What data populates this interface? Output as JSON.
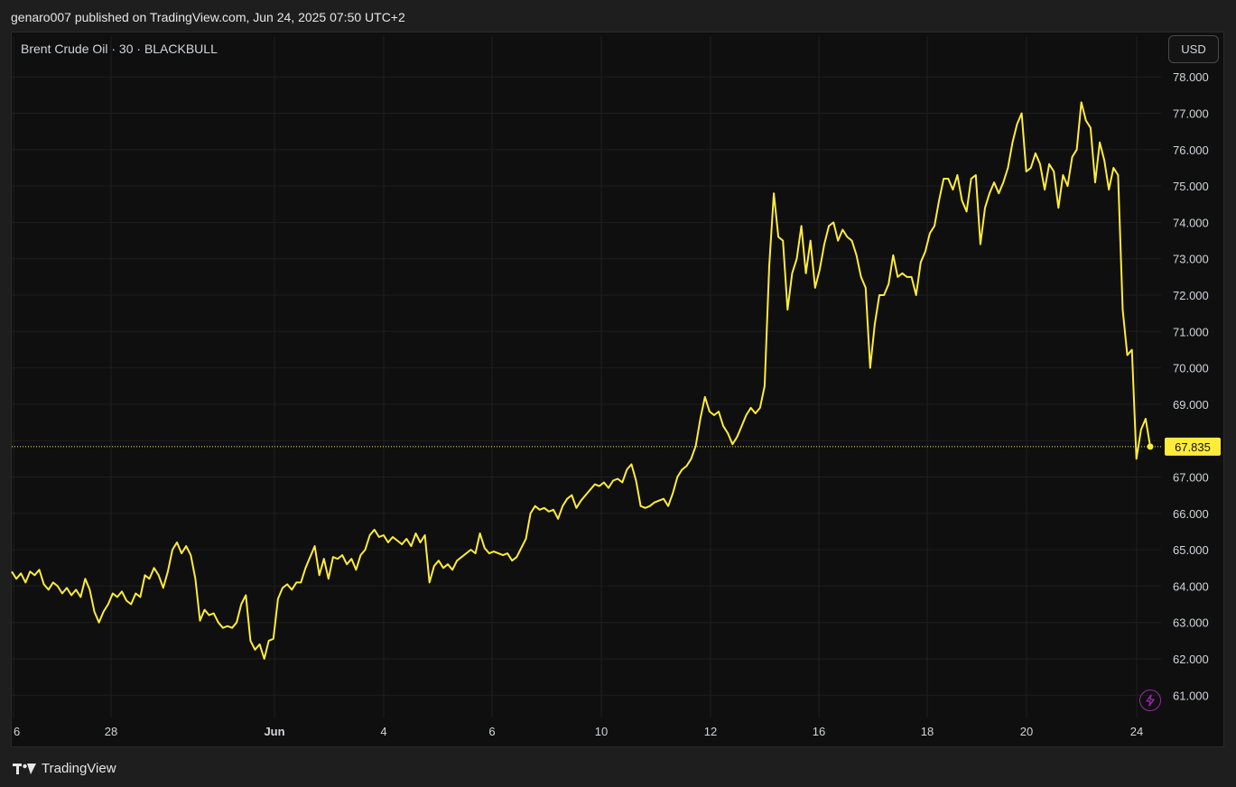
{
  "header": {
    "publish_text": "genaro007 published on TradingView.com, Jun 24, 2025 07:50 UTC+2"
  },
  "symbol": {
    "label": "Brent Crude Oil · 30 · BLACKBULL"
  },
  "currency": "USD",
  "brand": "TradingView",
  "icons": {
    "brand": "tradingview-logo-icon",
    "lightning": "lightning-icon"
  },
  "colors": {
    "line": "#ffeb3b",
    "background": "#0f0f0f",
    "grid": "#1f1f1f",
    "accent_purple": "#9c27b0"
  },
  "chart_data": {
    "type": "line",
    "ylim": [
      60.65,
      79.2
    ],
    "y_ticks": [
      "78.000",
      "77.000",
      "76.000",
      "75.000",
      "74.000",
      "73.000",
      "72.000",
      "71.000",
      "70.000",
      "69.000",
      "67.000",
      "66.000",
      "65.000",
      "64.000",
      "63.000",
      "62.000",
      "61.000"
    ],
    "x_ticks": [
      "6",
      "28",
      "Jun",
      "4",
      "6",
      "10",
      "12",
      "16",
      "18",
      "20",
      "24"
    ],
    "last_price": "67.835",
    "series": [
      {
        "values": [
          64.4,
          64.2,
          64.35,
          64.1,
          64.4,
          64.3,
          64.45,
          64.05,
          63.9,
          64.1,
          64.0,
          63.8,
          63.95,
          63.75,
          63.9,
          63.7,
          64.2,
          63.9,
          63.3,
          63.0,
          63.3,
          63.5,
          63.8,
          63.7,
          63.85,
          63.6,
          63.5,
          63.8,
          63.7,
          64.3,
          64.2,
          64.5,
          64.3,
          63.95,
          64.4,
          65.0,
          65.2,
          64.9,
          65.1,
          64.85,
          64.2,
          63.05,
          63.35,
          63.2,
          63.25,
          63.0,
          62.85,
          62.9,
          62.85,
          63.0,
          63.5,
          63.75,
          62.5,
          62.25,
          62.4,
          62.0,
          62.5,
          62.55,
          63.65,
          63.95,
          64.05,
          63.9,
          64.1,
          64.1,
          64.5,
          64.8,
          65.1,
          64.3,
          64.75,
          64.2,
          64.8,
          64.75,
          64.85,
          64.6,
          64.75,
          64.45,
          64.85,
          65.0,
          65.4,
          65.55,
          65.35,
          65.4,
          65.2,
          65.35,
          65.25,
          65.15,
          65.3,
          65.1,
          65.45,
          65.2,
          65.4,
          64.1,
          64.55,
          64.7,
          64.5,
          64.6,
          64.45,
          64.7,
          64.8,
          64.9,
          65.0,
          64.9,
          65.45,
          65.05,
          64.9,
          64.95,
          64.9,
          64.85,
          64.9,
          64.7,
          64.8,
          65.05,
          65.3,
          66.0,
          66.2,
          66.1,
          66.15,
          66.05,
          66.1,
          65.85,
          66.2,
          66.4,
          66.5,
          66.15,
          66.35,
          66.5,
          66.65,
          66.8,
          66.75,
          66.85,
          66.7,
          66.9,
          66.95,
          66.85,
          67.2,
          67.35,
          66.9,
          66.2,
          66.15,
          66.2,
          66.3,
          66.35,
          66.4,
          66.2,
          66.55,
          67.0,
          67.2,
          67.3,
          67.5,
          67.85,
          68.6,
          69.2,
          68.8,
          68.7,
          68.8,
          68.4,
          68.2,
          67.9,
          68.1,
          68.4,
          68.7,
          68.9,
          68.75,
          68.9,
          69.5,
          72.8,
          74.8,
          73.6,
          73.5,
          71.6,
          72.6,
          73.0,
          73.9,
          72.6,
          73.5,
          72.2,
          72.7,
          73.4,
          73.9,
          74.0,
          73.5,
          73.8,
          73.6,
          73.5,
          73.1,
          72.5,
          72.2,
          70.0,
          71.2,
          72.0,
          72.0,
          72.3,
          73.1,
          72.5,
          72.6,
          72.5,
          72.5,
          72.0,
          72.9,
          73.2,
          73.7,
          73.9,
          74.6,
          75.2,
          75.2,
          74.9,
          75.3,
          74.6,
          74.3,
          75.2,
          75.3,
          73.4,
          74.4,
          74.8,
          75.1,
          74.8,
          75.1,
          75.5,
          76.2,
          76.7,
          77.0,
          75.4,
          75.5,
          75.9,
          75.6,
          74.9,
          75.6,
          75.4,
          74.4,
          75.3,
          75.0,
          75.8,
          76.0,
          77.3,
          76.8,
          76.6,
          75.1,
          76.2,
          75.7,
          74.9,
          75.5,
          75.3,
          71.6,
          70.35,
          70.5,
          67.5,
          68.3,
          68.6,
          67.835
        ]
      }
    ]
  }
}
